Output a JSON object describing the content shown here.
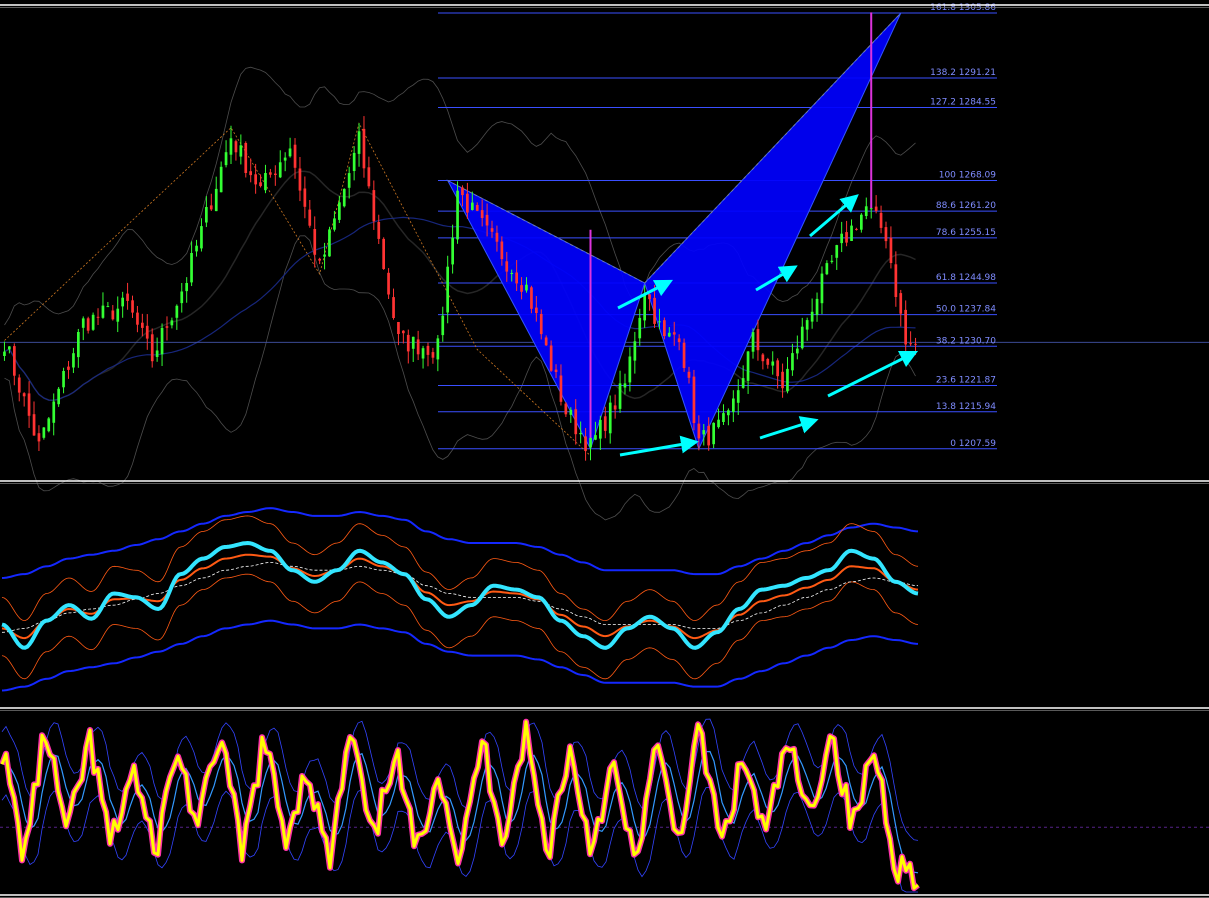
{
  "colors": {
    "background": "#000000",
    "bull_candle": "#33ff33",
    "bear_candle": "#ff3333",
    "fib_line": "#3a4fff",
    "fib_text": "#7f8cff",
    "pattern_fill": "#0000ff",
    "arrow": "#00ffff",
    "spike": "#dd33dd",
    "separator": "#ffffff",
    "rsi_line": "#33e5ff",
    "orange_line": "#ff5a14",
    "blue_band": "#1428ff",
    "stoch_main": "#ffff00",
    "stoch_outline": "#ff33aa",
    "stoch_signal": "#3399ff"
  },
  "chart_data": [
    {
      "type": "line",
      "panel": "price",
      "chart_style": "candlestick",
      "fib_levels": [
        {
          "ratio": 161.8,
          "price": 1305.86,
          "text": "161.8 1305.86"
        },
        {
          "ratio": 138.2,
          "price": 1291.21,
          "text": "138.2 1291.21"
        },
        {
          "ratio": 127.2,
          "price": 1284.55,
          "text": "127.2 1284.55"
        },
        {
          "ratio": 100,
          "price": 1268.09,
          "text": "100 1268.09"
        },
        {
          "ratio": 88.6,
          "price": 1261.2,
          "text": "88.6 1261.20"
        },
        {
          "ratio": 78.6,
          "price": 1255.15,
          "text": "78.6 1255.15"
        },
        {
          "ratio": 61.8,
          "price": 1244.98,
          "text": "61.8 1244.98"
        },
        {
          "ratio": 50.0,
          "price": 1237.84,
          "text": "50.0 1237.84"
        },
        {
          "ratio": 38.2,
          "price": 1230.7,
          "text": "38.2 1230.70"
        },
        {
          "ratio": 23.6,
          "price": 1221.87,
          "text": "23.6 1221.87"
        },
        {
          "ratio": 13.8,
          "price": 1215.94,
          "text": "13.8 1215.94"
        },
        {
          "ratio": 0,
          "price": 1207.59,
          "text": "0 1207.59"
        }
      ],
      "ylim": [
        1201,
        1307
      ],
      "harmonic_pattern": {
        "type": "bearish bat",
        "points": [
          {
            "bar": 90,
            "price": 1268.09
          },
          {
            "bar": 119,
            "price": 1207.59
          },
          {
            "bar": 130,
            "price": 1244.98
          },
          {
            "bar": 141,
            "price": 1207.59
          },
          {
            "bar": 182,
            "price": 1305.86
          }
        ]
      },
      "price_path": [
        {
          "bar": 0,
          "price": 1232
        },
        {
          "bar": 7,
          "price": 1208
        },
        {
          "bar": 16,
          "price": 1236
        },
        {
          "bar": 25,
          "price": 1240
        },
        {
          "bar": 30,
          "price": 1228
        },
        {
          "bar": 37,
          "price": 1246
        },
        {
          "bar": 46,
          "price": 1278
        },
        {
          "bar": 52,
          "price": 1266
        },
        {
          "bar": 58,
          "price": 1276
        },
        {
          "bar": 64,
          "price": 1248
        },
        {
          "bar": 72,
          "price": 1277
        },
        {
          "bar": 80,
          "price": 1232
        },
        {
          "bar": 88,
          "price": 1230
        },
        {
          "bar": 92,
          "price": 1266
        },
        {
          "bar": 98,
          "price": 1256
        },
        {
          "bar": 106,
          "price": 1244
        },
        {
          "bar": 114,
          "price": 1216
        },
        {
          "bar": 119,
          "price": 1208
        },
        {
          "bar": 126,
          "price": 1222
        },
        {
          "bar": 130,
          "price": 1244
        },
        {
          "bar": 134,
          "price": 1232
        },
        {
          "bar": 137,
          "price": 1234
        },
        {
          "bar": 141,
          "price": 1209
        },
        {
          "bar": 147,
          "price": 1214
        },
        {
          "bar": 152,
          "price": 1232
        },
        {
          "bar": 158,
          "price": 1222
        },
        {
          "bar": 164,
          "price": 1240
        },
        {
          "bar": 170,
          "price": 1254
        },
        {
          "bar": 175,
          "price": 1262
        },
        {
          "bar": 179,
          "price": 1256
        },
        {
          "bar": 183,
          "price": 1231
        }
      ],
      "spikes": [
        {
          "bar": 119,
          "price": 1257
        },
        {
          "bar": 176,
          "price": 1306
        }
      ]
    },
    {
      "type": "line",
      "panel": "oscillator_1",
      "series": [
        {
          "values": [
            42,
            30,
            44,
            52,
            45,
            58,
            56,
            50,
            68,
            76,
            82,
            84,
            80,
            70,
            64,
            70,
            80,
            74,
            68,
            55,
            46,
            52,
            62,
            60,
            56,
            44,
            36,
            30,
            40,
            46,
            40,
            30,
            38,
            50,
            60,
            62,
            66,
            70,
            80,
            76,
            64,
            58
          ]
        },
        {
          "values": [
            38,
            40,
            44,
            48,
            50,
            52,
            55,
            58,
            62,
            66,
            70,
            72,
            74,
            72,
            70,
            70,
            72,
            70,
            68,
            62,
            58,
            56,
            56,
            56,
            54,
            50,
            46,
            42,
            42,
            42,
            42,
            40,
            40,
            44,
            48,
            52,
            56,
            60,
            64,
            66,
            64,
            62
          ]
        }
      ]
    },
    {
      "type": "line",
      "panel": "oscillator_2",
      "series": [
        {
          "values": [
            80,
            20,
            90,
            30,
            85,
            25,
            70,
            20,
            80,
            35,
            90,
            20,
            85,
            30,
            70,
            15,
            90,
            25,
            80,
            20,
            70,
            15,
            85,
            30,
            90,
            20,
            80,
            25,
            70,
            15,
            80,
            30,
            90,
            25,
            75,
            30,
            85,
            40,
            90,
            35,
            80,
            15,
            10
          ]
        }
      ]
    }
  ]
}
